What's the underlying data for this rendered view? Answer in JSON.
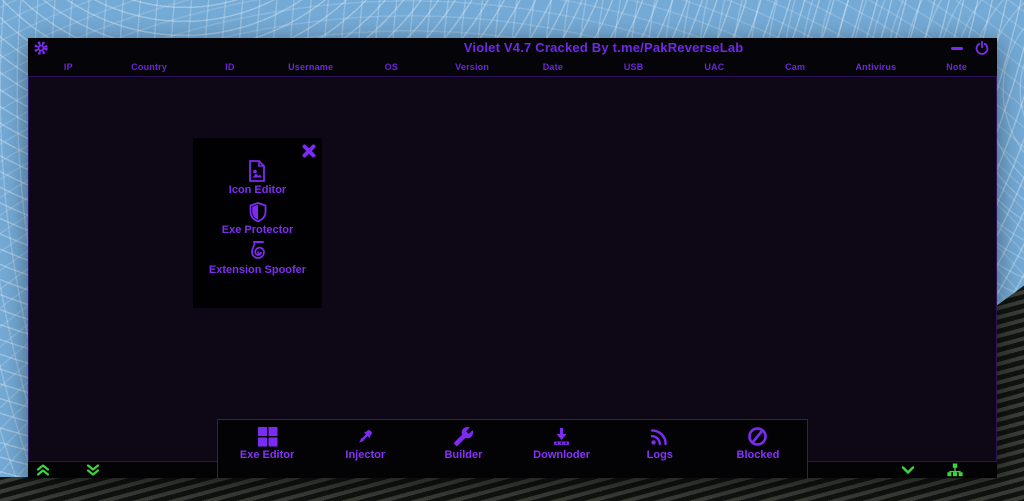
{
  "window": {
    "title": "Violet V4.7 Cracked By t.me/PakReverseLab"
  },
  "table": {
    "columns": [
      "IP",
      "Country",
      "ID",
      "Username",
      "OS",
      "Version",
      "Date",
      "USB",
      "UAC",
      "Cam",
      "Antivirus",
      "Note"
    ]
  },
  "popup": {
    "items": [
      {
        "icon": "image-file-icon",
        "label": "Icon Editor"
      },
      {
        "icon": "shield-icon",
        "label": "Exe Protector"
      },
      {
        "icon": "spiral-icon",
        "label": "Extension Spoofer"
      }
    ]
  },
  "tabbar": {
    "tabs": [
      {
        "icon": "windows-icon",
        "label": "Exe Editor"
      },
      {
        "icon": "dropper-icon",
        "label": "Injector"
      },
      {
        "icon": "wrench-icon",
        "label": "Builder"
      },
      {
        "icon": "download-icon",
        "label": "Downloder"
      },
      {
        "icon": "rss-icon",
        "label": "Logs"
      },
      {
        "icon": "blocked-icon",
        "label": "Blocked"
      }
    ]
  },
  "colors": {
    "accent_purple": "#7c2bf2",
    "title_purple": "#6f2ae3",
    "header_purple": "#6c27d6",
    "tab_purple": "#8831fb",
    "green": "#3ed43e",
    "body_bg": "#0d0716",
    "bar_bg": "#050408"
  }
}
